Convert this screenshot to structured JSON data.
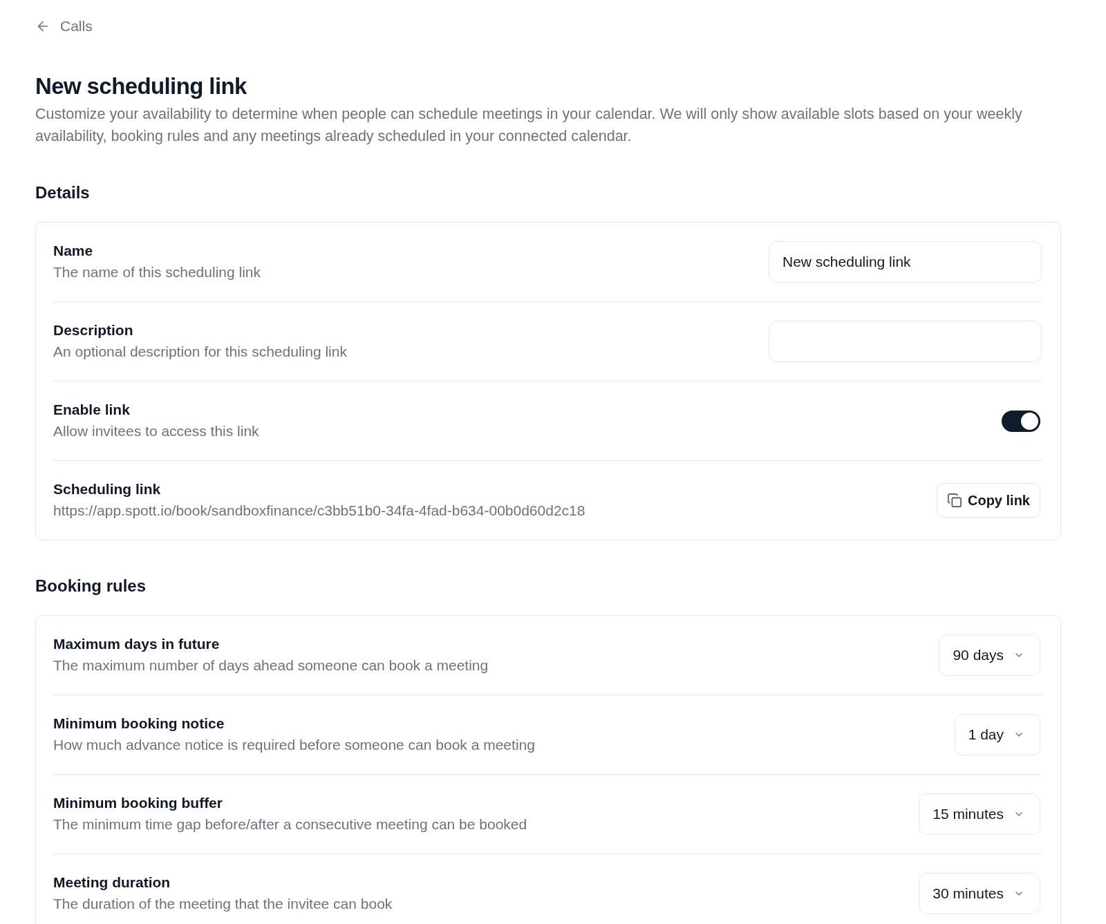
{
  "back_link": {
    "label": "Calls"
  },
  "page": {
    "title": "New scheduling link",
    "description": "Customize your availability to determine when people can schedule meetings in your calendar. We will only show available slots based on your weekly availability, booking rules and any meetings already scheduled in your connected calendar."
  },
  "sections": [
    {
      "title": "Details",
      "rows": [
        {
          "kind": "text",
          "label": "Name",
          "description": "The name of this scheduling link",
          "value": "New scheduling link"
        },
        {
          "kind": "text",
          "label": "Description",
          "description": "An optional description for this scheduling link"
        },
        {
          "kind": "toggle",
          "label": "Enable link",
          "description": "Allow invitees to access this link",
          "on": true
        },
        {
          "kind": "copy",
          "label": "Scheduling link",
          "description": "https://app.spott.io/book/sandboxfinance/c3bb51b0-34fa-4fad-b634-00b0d60d2c18",
          "button": "Copy link"
        }
      ]
    },
    {
      "title": "Booking rules",
      "rows": [
        {
          "kind": "select",
          "label": "Maximum days in future",
          "description": "The maximum number of days ahead someone can book a meeting",
          "value": "90 days"
        },
        {
          "kind": "select",
          "label": "Minimum booking notice",
          "description": "How much advance notice is required before someone can book a meeting",
          "value": "1 day"
        },
        {
          "kind": "select",
          "label": "Minimum booking buffer",
          "description": "The minimum time gap before/after a consecutive meeting can be booked",
          "value": "15 minutes"
        },
        {
          "kind": "select",
          "label": "Meeting duration",
          "description": "The duration of the meeting that the invitee can book",
          "value": "30 minutes"
        }
      ]
    }
  ]
}
